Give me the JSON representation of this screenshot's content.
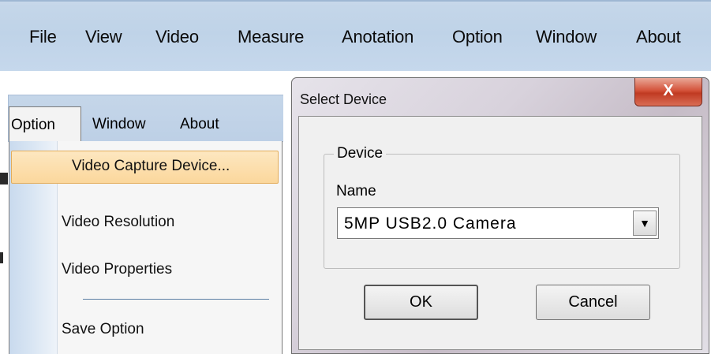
{
  "menubar": {
    "items": [
      "File",
      "View",
      "Video",
      "Measure",
      "Anotation",
      "Option",
      "Window",
      "About"
    ]
  },
  "option_menu": {
    "tabs": [
      "Option",
      "Window",
      "About"
    ],
    "items": [
      "Video Capture Device...",
      "Video Resolution",
      "Video Properties",
      "Save Option"
    ]
  },
  "dialog": {
    "title": "Select Device",
    "close_glyph": "X",
    "group_label": "Device",
    "name_label": "Name",
    "device_value": "5MP USB2.0 Camera",
    "ok_label": "OK",
    "cancel_label": "Cancel"
  },
  "colors": {
    "menubar_bg": "#c4d6e9",
    "highlight": "#fbd79c",
    "close_button": "#c03a22"
  },
  "icons": {
    "dropdown_arrow": "chevron-down-icon",
    "close": "close-icon"
  }
}
